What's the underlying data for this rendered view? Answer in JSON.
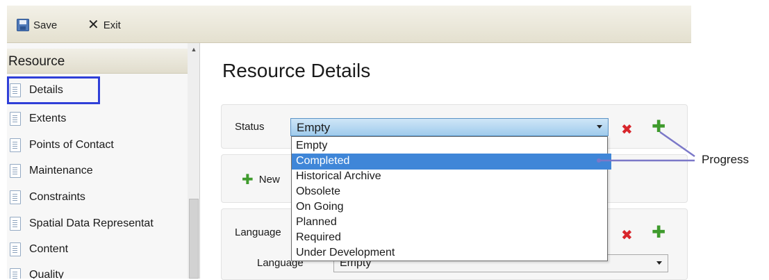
{
  "toolbar": {
    "save_label": "Save",
    "exit_label": "Exit"
  },
  "nav": {
    "header": "Resource",
    "items": [
      {
        "label": "Details",
        "icon": "document-icon"
      },
      {
        "label": "Extents",
        "icon": "document-icon"
      },
      {
        "label": "Points of Contact",
        "icon": "document-icon"
      },
      {
        "label": "Maintenance",
        "icon": "document-icon"
      },
      {
        "label": "Constraints",
        "icon": "document-icon"
      },
      {
        "label": "Spatial Data Representat",
        "icon": "document-icon"
      },
      {
        "label": "Content",
        "icon": "document-icon"
      },
      {
        "label": "Quality",
        "icon": "document-icon"
      }
    ],
    "highlight_color": "#2f3fd8"
  },
  "main": {
    "title": "Resource Details",
    "status": {
      "label": "Status",
      "selected": "Empty",
      "options": [
        "Empty",
        "Completed",
        "Historical Archive",
        "Obsolete",
        "On Going",
        "Planned",
        "Required",
        "Under Development"
      ],
      "highlighted_option": "Completed"
    },
    "new_label": "New",
    "language_section_label": "Language",
    "language_field_label": "Language",
    "language_selected": "Empty"
  },
  "callout": {
    "label": "Progress",
    "color": "#7b78c8"
  },
  "colors": {
    "remove": "#d8262c",
    "add": "#3f9b2d",
    "selection": "#3f86d8"
  }
}
